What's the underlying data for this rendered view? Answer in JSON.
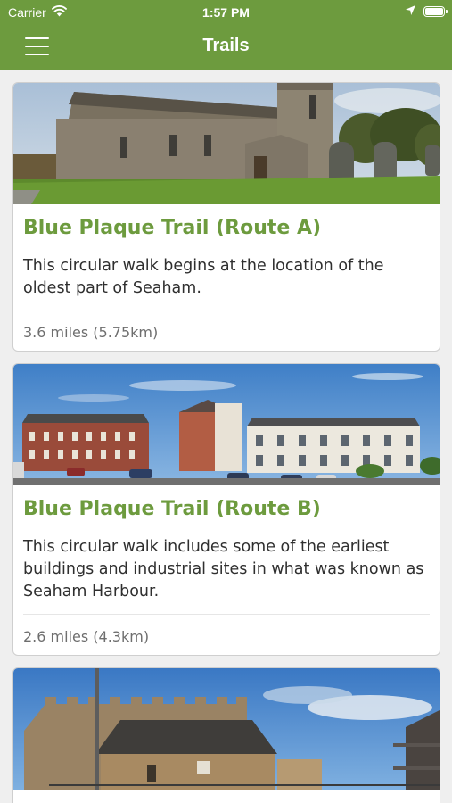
{
  "status_bar": {
    "carrier": "Carrier",
    "time": "1:57 PM",
    "wifi_icon": "wifi-icon",
    "location_icon": "location-arrow-icon",
    "battery_icon": "battery-icon"
  },
  "header": {
    "title": "Trails",
    "menu_icon": "hamburger-menu-icon",
    "background_color": "#6d9b3e"
  },
  "trails": [
    {
      "title": "Blue Plaque Trail (Route A)",
      "description": "This circular walk begins at the location of the oldest part of Seaham.",
      "distance": "3.6 miles (5.75km)",
      "image": "stone-church-photo"
    },
    {
      "title": "Blue Plaque Trail (Route B)",
      "description": "This circular walk includes some of the earliest buildings and industrial sites in what was known as Seaham Harbour.",
      "distance": "2.6 miles (4.3km)",
      "image": "terraced-houses-photo"
    },
    {
      "title": "",
      "description": "",
      "distance": "",
      "image": "castle-building-photo"
    }
  ],
  "colors": {
    "accent": "#6d9b3e",
    "text": "#2f2f2f",
    "muted": "#6e6e6e"
  }
}
